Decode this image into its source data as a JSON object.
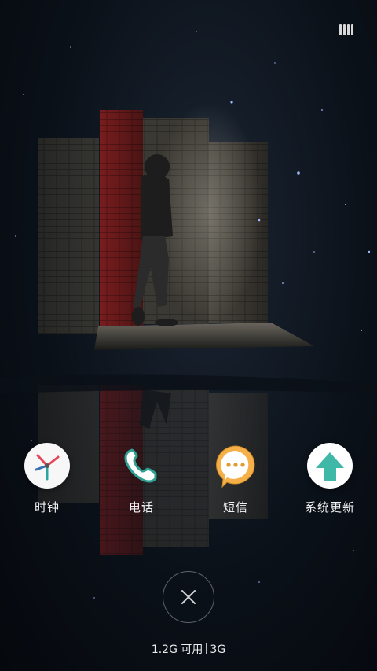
{
  "apps": [
    {
      "label": "时钟",
      "icon": "clock-icon"
    },
    {
      "label": "电话",
      "icon": "phone-icon"
    },
    {
      "label": "短信",
      "icon": "message-icon"
    },
    {
      "label": "系统更新",
      "icon": "system-update-icon"
    }
  ],
  "memory": {
    "available": "1.2G 可用",
    "total": "3G"
  },
  "colors": {
    "clock_bg": "#f7f7f7",
    "phone_bg": "#ffffff",
    "message_bg": "#f5b04a",
    "update_bg": "#ffffff",
    "accent_teal": "#3fb8a8"
  }
}
